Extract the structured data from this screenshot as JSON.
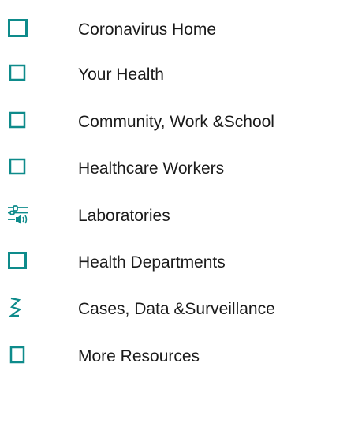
{
  "accent_color": "#0e8b8b",
  "text_color": "#1a1a1a",
  "nav": {
    "items": [
      {
        "label": "Coronavirus Home",
        "icon": "home-icon"
      },
      {
        "label": "Your Health",
        "icon": "your-health-icon"
      },
      {
        "label": "Community, Work &School",
        "icon": "community-icon"
      },
      {
        "label": "Healthcare Workers",
        "icon": "healthcare-workers-icon"
      },
      {
        "label": "Laboratories",
        "icon": "laboratories-icon"
      },
      {
        "label": "Health Departments",
        "icon": "health-departments-icon"
      },
      {
        "label": "Cases, Data &Surveillance",
        "icon": "cases-data-icon"
      },
      {
        "label": "More Resources",
        "icon": "more-resources-icon"
      }
    ]
  }
}
